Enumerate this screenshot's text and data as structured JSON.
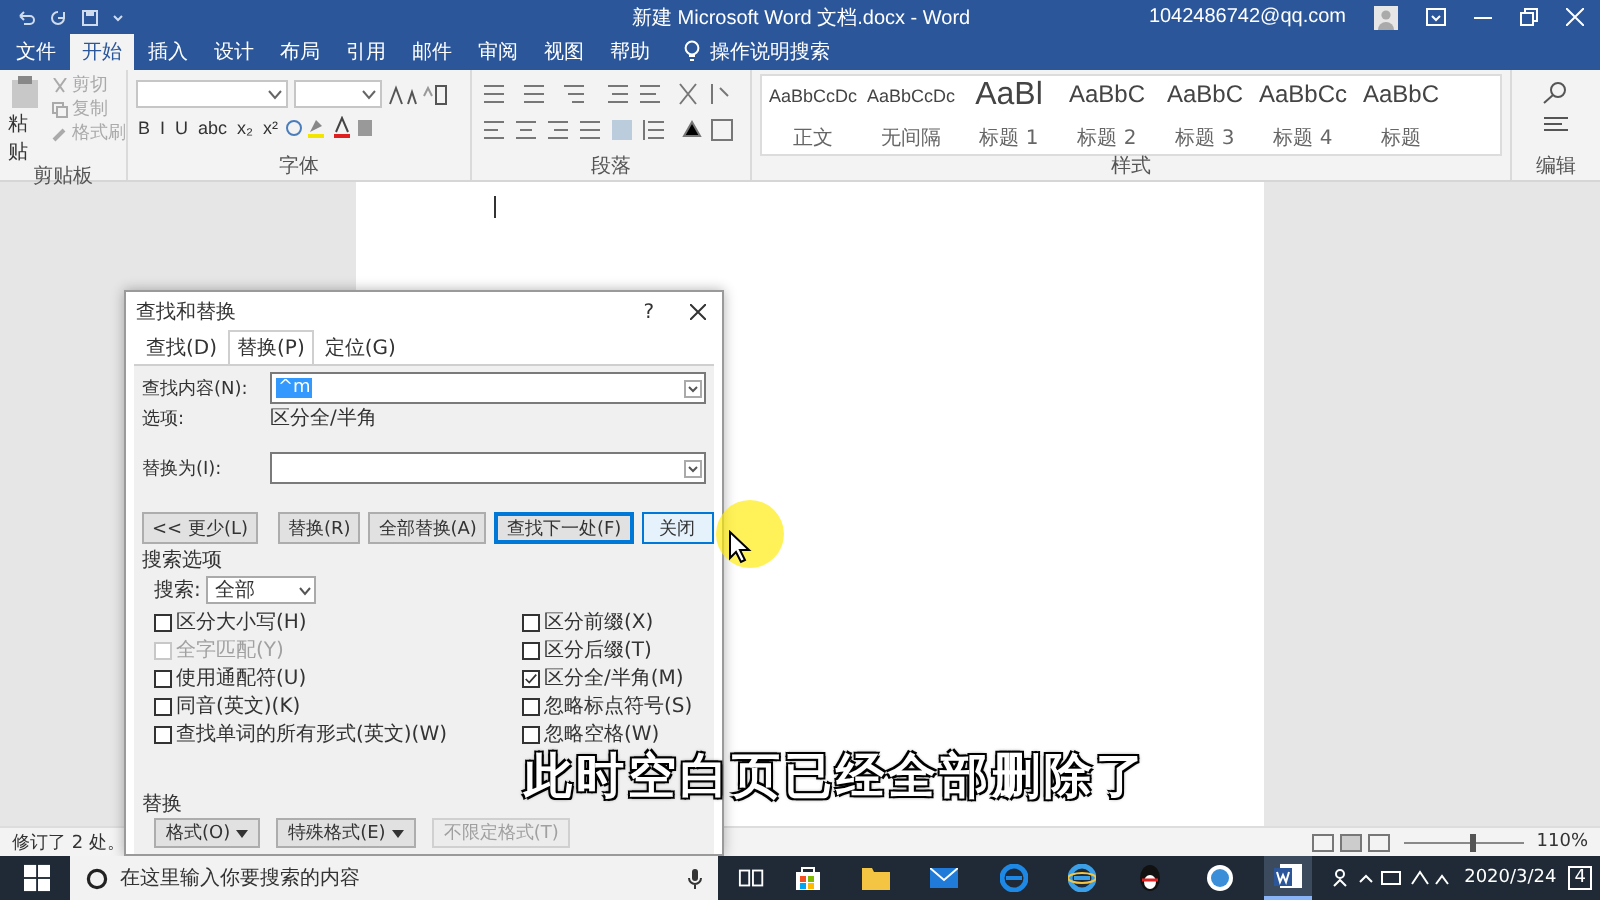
{
  "window": {
    "title": "新建 Microsoft Word 文档.docx - Word",
    "account": "1042486742@qq.com"
  },
  "ribbon_tabs": [
    {
      "label": "文件",
      "selected": false
    },
    {
      "label": "开始",
      "selected": true
    },
    {
      "label": "插入",
      "selected": false
    },
    {
      "label": "设计",
      "selected": false
    },
    {
      "label": "布局",
      "selected": false
    },
    {
      "label": "引用",
      "selected": false
    },
    {
      "label": "邮件",
      "selected": false
    },
    {
      "label": "审阅",
      "selected": false
    },
    {
      "label": "视图",
      "selected": false
    },
    {
      "label": "帮助",
      "selected": false
    }
  ],
  "tell_me": "操作说明搜索",
  "clipboard": {
    "paste": "粘贴",
    "cut": "剪切",
    "copy": "复制",
    "format_painter": "格式刷",
    "label": "剪贴板"
  },
  "font": {
    "buttons": [
      "B",
      "I",
      "U",
      "abc",
      "x₂",
      "x²"
    ],
    "label": "字体"
  },
  "paragraph": {
    "label": "段落"
  },
  "styles": {
    "label": "样式",
    "items": [
      {
        "preview": "AaBbCcDc",
        "name": "正文",
        "kind": "small"
      },
      {
        "preview": "AaBbCcDc",
        "name": "无间隔",
        "kind": "small"
      },
      {
        "preview": "AaBl",
        "name": "标题 1",
        "kind": "large"
      },
      {
        "preview": "AaBbC",
        "name": "标题 2",
        "kind": "medium"
      },
      {
        "preview": "AaBbC",
        "name": "标题 3",
        "kind": "medium"
      },
      {
        "preview": "AaBbCc",
        "name": "标题 4",
        "kind": "medium"
      },
      {
        "preview": "AaBbC",
        "name": "标题",
        "kind": "medium"
      }
    ]
  },
  "editing": {
    "label": "编辑"
  },
  "dialog": {
    "title": "查找和替换",
    "help": "?",
    "tabs": [
      {
        "label": "查找(D)",
        "selected": false
      },
      {
        "label": "替换(P)",
        "selected": true
      },
      {
        "label": "定位(G)",
        "selected": false
      }
    ],
    "find_label": "查找内容(N):",
    "find_value": "^m",
    "options_label": "选项:",
    "options_value": "区分全/半角",
    "replace_label": "替换为(I):",
    "buttons": [
      {
        "label": "<< 更少(L)",
        "focused": false,
        "hovered": false
      },
      {
        "label": "替换(R)",
        "focused": false,
        "hovered": false
      },
      {
        "label": "全部替换(A)",
        "focused": false,
        "hovered": false
      },
      {
        "label": "查找下一处(F)",
        "focused": true,
        "hovered": false
      },
      {
        "label": "关闭",
        "focused": false,
        "hovered": true
      }
    ],
    "search_options_label": "搜索选项",
    "search_label": "搜索:",
    "search_value": "全部",
    "left_options": [
      {
        "label": "区分大小写(H)",
        "checked": false,
        "disabled": false
      },
      {
        "label": "全字匹配(Y)",
        "checked": false,
        "disabled": true
      },
      {
        "label": "使用通配符(U)",
        "checked": false,
        "disabled": false
      },
      {
        "label": "同音(英文)(K)",
        "checked": false,
        "disabled": false
      },
      {
        "label": "查找单词的所有形式(英文)(W)",
        "checked": false,
        "disabled": false
      }
    ],
    "right_options": [
      {
        "label": "区分前缀(X)",
        "checked": false,
        "disabled": false
      },
      {
        "label": "区分后缀(T)",
        "checked": false,
        "disabled": false
      },
      {
        "label": "区分全/半角(M)",
        "checked": true,
        "disabled": false
      },
      {
        "label": "忽略标点符号(S)",
        "checked": false,
        "disabled": false
      },
      {
        "label": "忽略空格(W)",
        "checked": false,
        "disabled": false
      }
    ],
    "replace_section_label": "替换",
    "format_buttons": [
      {
        "label": "格式(O)",
        "menu": true,
        "disabled": false
      },
      {
        "label": "特殊格式(E)",
        "menu": true,
        "disabled": false
      },
      {
        "label": "不限定格式(T)",
        "menu": false,
        "disabled": true
      }
    ]
  },
  "status_bar": {
    "left": "修订了 2 处。",
    "zoom_slider": {
      "level": 0.55
    },
    "zoom": "110%"
  },
  "caption": "此时空白页已经全部删除了",
  "taskbar": {
    "search_placeholder": "在这里输入你要搜索的内容",
    "date": "2020/3/24",
    "notification_count": "4",
    "apps": [
      {
        "kind": "store",
        "active": false
      },
      {
        "kind": "folder",
        "active": false
      },
      {
        "kind": "mail",
        "active": false
      },
      {
        "kind": "edge",
        "active": false
      },
      {
        "kind": "ie",
        "active": false
      },
      {
        "kind": "qq",
        "active": false
      },
      {
        "kind": "globe",
        "active": false
      },
      {
        "kind": "word",
        "active": true
      }
    ]
  }
}
